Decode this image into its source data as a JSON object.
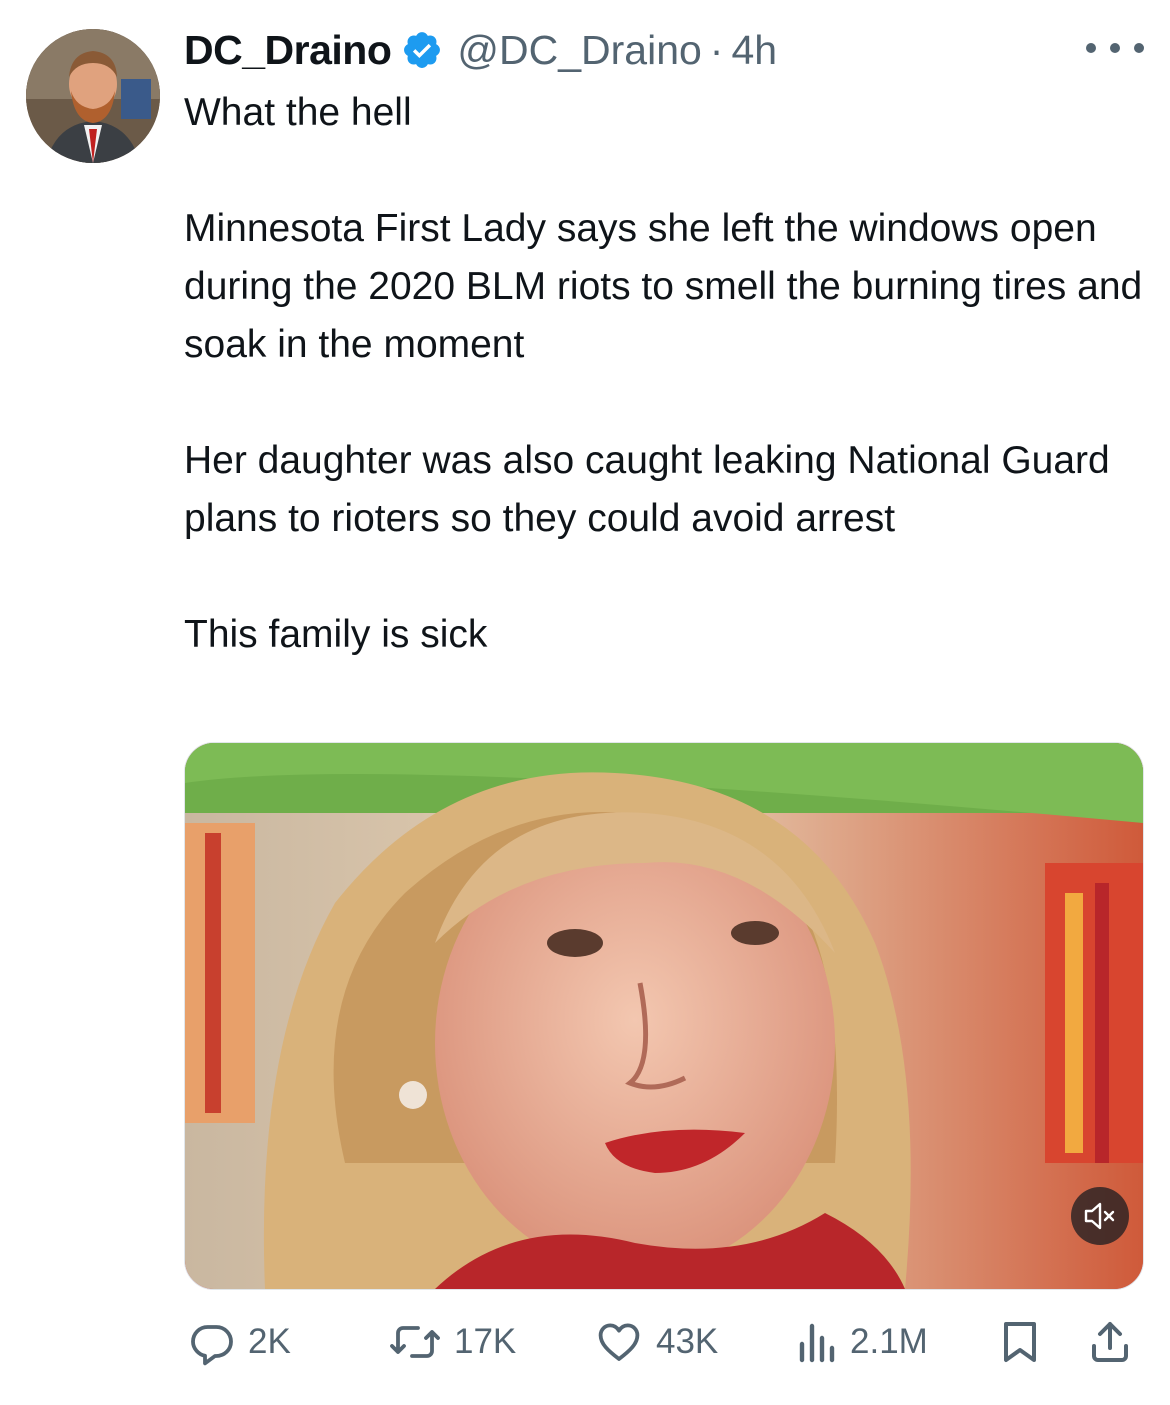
{
  "author": {
    "display_name": "DC_Draino",
    "handle": "@DC_Draino",
    "separator": "·",
    "time": "4h",
    "verified": true
  },
  "tweet": {
    "text": "What the hell\n\nMinnesota First Lady says she left the windows open during the 2020 BLM riots to smell the burning tires and soak in the moment\n\nHer daughter was also caught leaking National Guard plans to rioters so they could avoid arrest\n\nThis family is sick"
  },
  "media": {
    "type": "video",
    "muted": true
  },
  "actions": {
    "replies": "2K",
    "reposts": "17K",
    "likes": "43K",
    "views": "2.1M"
  },
  "icons": {
    "verified": "verified-badge-icon",
    "more": "more-icon",
    "reply": "reply-icon",
    "repost": "repost-icon",
    "like": "heart-icon",
    "views": "views-icon",
    "bookmark": "bookmark-icon",
    "share": "share-icon",
    "mute": "muted-speaker-icon"
  },
  "colors": {
    "text": "#0f1419",
    "secondary": "#536471",
    "verified": "#1d9bf0"
  }
}
